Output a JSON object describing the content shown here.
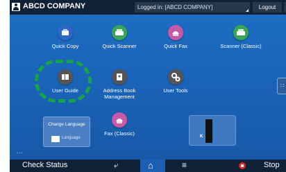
{
  "header": {
    "user_name": "ABCD COMPANY",
    "login_status": "Logged in: [ABCD COMPANY]",
    "logout_label": "Logout"
  },
  "apps": [
    {
      "label": "Quick Copy",
      "icon": "copy-icon",
      "color": "#2f67c7"
    },
    {
      "label": "Quick Scanner",
      "icon": "scanner-icon",
      "color": "#3aa55a"
    },
    {
      "label": "Quick Fax",
      "icon": "fax-icon",
      "color": "#c75aa8"
    },
    {
      "label": "Scanner (Classic)",
      "icon": "scanner-classic-icon",
      "color": "#3aa55a"
    },
    {
      "label": "User Guide",
      "icon": "book-icon",
      "color": "#555555"
    },
    {
      "label": "Address Book Management",
      "icon": "address-book-icon",
      "color": "#555555"
    },
    {
      "label": "User Tools",
      "icon": "gears-icon",
      "color": "#555555"
    },
    {
      "label": "Fax (Classic)",
      "icon": "fax-classic-icon",
      "color": "#c75aa8"
    }
  ],
  "language_widget": {
    "title": "Change Language",
    "button_label": "Language"
  },
  "counter_widget": {
    "letter": "K"
  },
  "more_indicator": "...",
  "bottom_bar": {
    "check_status_label": "Check Status",
    "stop_label": "Stop"
  }
}
